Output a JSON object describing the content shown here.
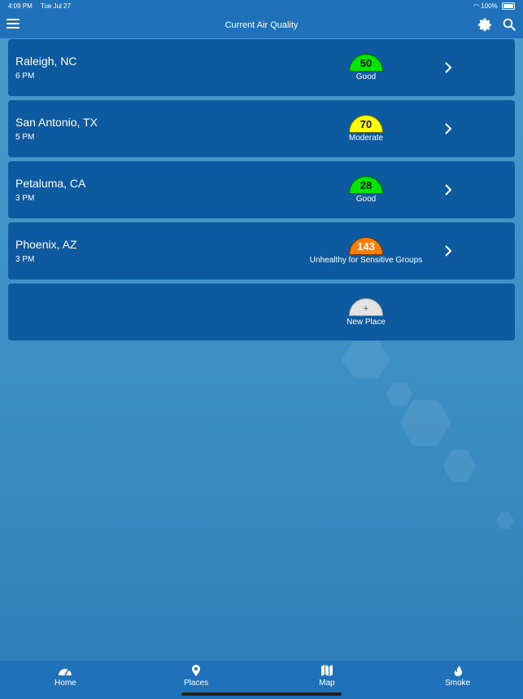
{
  "status": {
    "time": "4:09 PM",
    "date": "Tue Jul 27",
    "battery": "100%"
  },
  "header": {
    "title": "Current Air Quality",
    "menu_icon": "menu-icon",
    "settings_icon": "gear-icon",
    "search_icon": "search-icon"
  },
  "places": [
    {
      "city": "Raleigh, NC",
      "time": "6 PM",
      "aqi": "50",
      "category": "Good",
      "color": "#00e400"
    },
    {
      "city": "San Antonio, TX",
      "time": "5 PM",
      "aqi": "70",
      "category": "Moderate",
      "color": "#ffff00"
    },
    {
      "city": "Petaluma, CA",
      "time": "3 PM",
      "aqi": "28",
      "category": "Good",
      "color": "#00e400"
    },
    {
      "city": "Phoenix, AZ",
      "time": "3 PM",
      "aqi": "143",
      "category": "Unhealthy for Sensitive Groups",
      "color": "#ff7e00"
    }
  ],
  "new_place": {
    "icon": "+",
    "label": "New Place"
  },
  "tabs": [
    {
      "label": "Home",
      "icon": "gauge-icon"
    },
    {
      "label": "Places",
      "icon": "map-pin-icon"
    },
    {
      "label": "Map",
      "icon": "map-icon"
    },
    {
      "label": "Smoke",
      "icon": "fire-icon"
    }
  ]
}
